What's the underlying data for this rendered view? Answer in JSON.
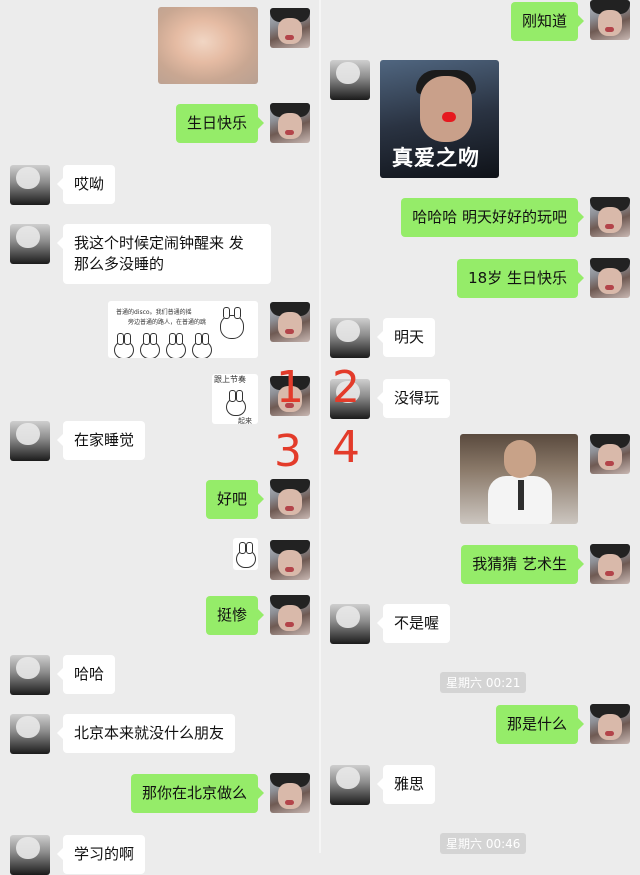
{
  "left": {
    "messages": [
      {
        "side": "right",
        "text": "生日快乐"
      },
      {
        "side": "left",
        "text": "哎呦"
      },
      {
        "side": "left",
        "text": "我这个时候定闹钟醒来 发\n那么多没睡的"
      },
      {
        "side": "left",
        "text": "在家睡觉"
      },
      {
        "side": "right",
        "text": "好吧"
      },
      {
        "side": "right",
        "text": "挺惨"
      },
      {
        "side": "left",
        "text": "哈哈"
      },
      {
        "side": "left",
        "text": "北京本来就没什么朋友"
      },
      {
        "side": "right",
        "text": "那你在北京做么"
      },
      {
        "side": "left",
        "text": "学习的啊"
      }
    ],
    "sticker1": {
      "lines": [
        "普通的disco。我们普通的摇",
        "旁边普通的路人，在普通的跳"
      ]
    },
    "sticker2": {
      "lines": [
        "跟上节奏",
        "起来"
      ]
    }
  },
  "right": {
    "messages": [
      {
        "side": "right",
        "text": "刚知道"
      },
      {
        "side": "right",
        "text": "哈哈哈 明天好好的玩吧"
      },
      {
        "side": "right",
        "text": "18岁 生日快乐"
      },
      {
        "side": "left",
        "text": "明天"
      },
      {
        "side": "left",
        "text": "没得玩"
      },
      {
        "side": "right",
        "text": "我猜猜 艺术生"
      },
      {
        "side": "left",
        "text": "不是喔"
      },
      {
        "side": "right",
        "text": "那是什么"
      },
      {
        "side": "left",
        "text": "雅思"
      }
    ],
    "photo_caption": "真爱之吻",
    "timestamps": [
      "星期六 00:21",
      "星期六 00:46"
    ]
  },
  "annotations": [
    "1",
    "2",
    "3",
    "4"
  ],
  "colors": {
    "bg": "#ececec",
    "sent": "#95ec69",
    "received": "#ffffff",
    "marker": "#e33b2a"
  }
}
